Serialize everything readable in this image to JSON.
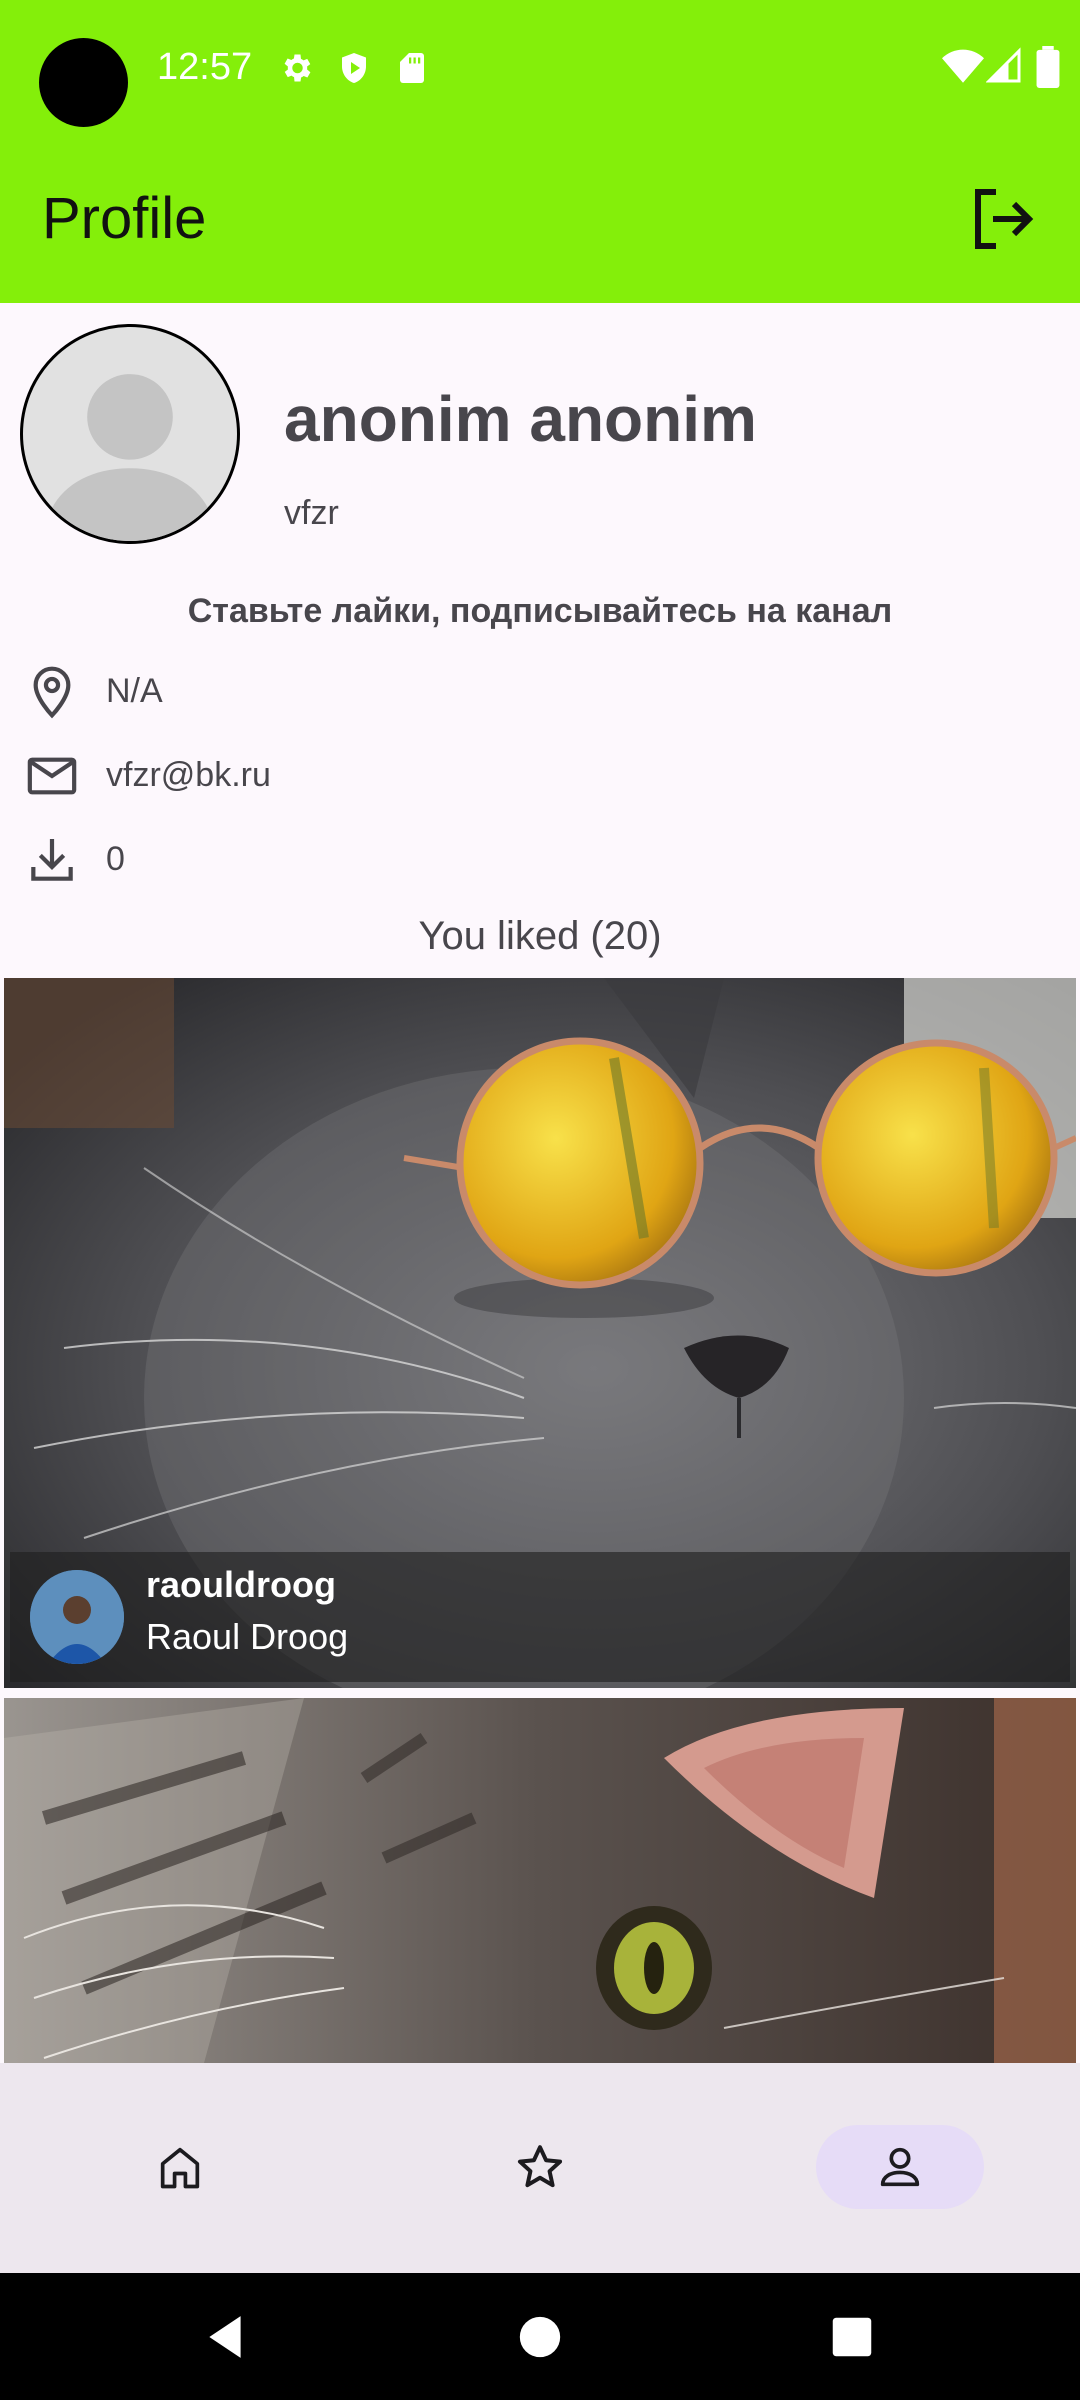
{
  "status_bar": {
    "time": "12:57",
    "left_icons": [
      "settings-icon",
      "shield-play-icon",
      "sd-card-icon"
    ],
    "right_icons": [
      "wifi-icon",
      "signal-icon",
      "battery-icon"
    ]
  },
  "app_bar": {
    "title": "Profile",
    "action_icon": "logout-icon",
    "background": "#84ef0a"
  },
  "profile": {
    "full_name": "anonim anonim",
    "username": "vfzr",
    "bio": "Ставьте лайки, подписывайтесь на канал",
    "location": "N/A",
    "email": "vfzr@bk.ru",
    "downloads": "0"
  },
  "liked": {
    "title": "You liked (20)",
    "photos": [
      {
        "author_username": "raouldroog",
        "author_name": "Raoul Droog"
      },
      {
        "author_username": "",
        "author_name": ""
      }
    ]
  },
  "bottom_nav": {
    "items": [
      {
        "icon": "home-icon",
        "active": false
      },
      {
        "icon": "star-icon",
        "active": false
      },
      {
        "icon": "profile-icon",
        "active": true
      }
    ]
  },
  "system_nav": [
    "back-icon",
    "home-circle-icon",
    "recents-icon"
  ]
}
